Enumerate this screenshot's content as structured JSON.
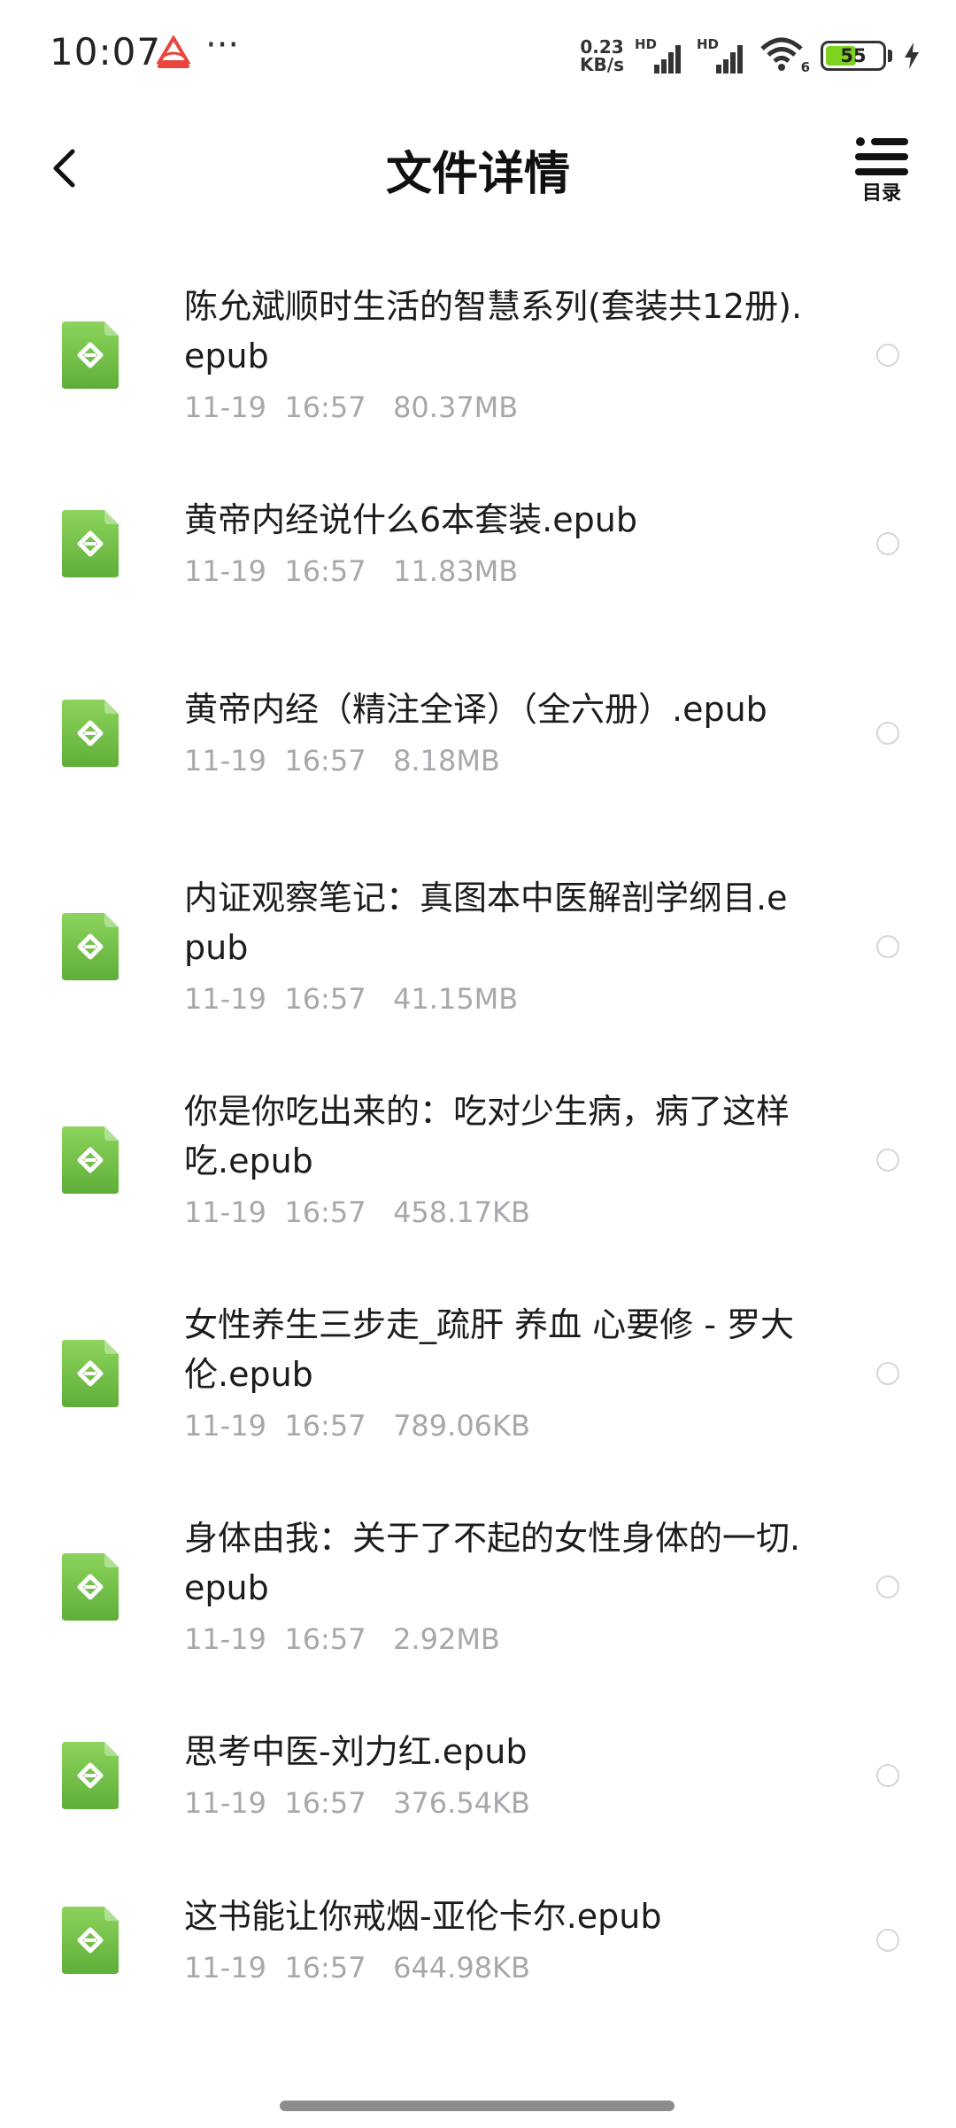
{
  "status_bar": {
    "time": "10:07",
    "dots": "···",
    "net_speed_value": "0.23",
    "net_speed_unit": "KB/s",
    "hd1": "HD",
    "hd2": "HD",
    "wifi_label": "6",
    "battery_percent": "55",
    "battery_level": 0.55,
    "battery_color": "#7ed321",
    "icons": [
      "app-notification-icon",
      "signal-icon",
      "wifi-icon",
      "battery-icon",
      "charging-icon"
    ]
  },
  "header": {
    "title": "文件详情",
    "toc_label": "目录",
    "back_icon": "chevron-left-icon",
    "toc_icon": "list-icon"
  },
  "files": [
    {
      "name": "陈允斌顺时生活的智慧系列(套装共12册).epub",
      "date": "11-19",
      "time": "16:57",
      "size": "80.37MB"
    },
    {
      "name": "黄帝内经说什么6本套装.epub",
      "date": "11-19",
      "time": "16:57",
      "size": "11.83MB"
    },
    {
      "name": "黄帝内经（精注全译）（全六册）.epub",
      "date": "11-19",
      "time": "16:57",
      "size": "8.18MB"
    },
    {
      "name": "内证观察笔记：真图本中医解剖学纲目.epub",
      "date": "11-19",
      "time": "16:57",
      "size": "41.15MB"
    },
    {
      "name": "你是你吃出来的：吃对少生病，病了这样吃.epub",
      "date": "11-19",
      "time": "16:57",
      "size": "458.17KB"
    },
    {
      "name": "女性养生三步走_疏肝 养血 心要修 - 罗大伦.epub",
      "date": "11-19",
      "time": "16:57",
      "size": "789.06KB"
    },
    {
      "name": "身体由我：关于了不起的女性身体的一切.epub",
      "date": "11-19",
      "time": "16:57",
      "size": "2.92MB"
    },
    {
      "name": "思考中医-刘力红.epub",
      "date": "11-19",
      "time": "16:57",
      "size": "376.54KB"
    },
    {
      "name": "这书能让你戒烟-亚伦卡尔.epub",
      "date": "11-19",
      "time": "16:57",
      "size": "644.98KB"
    }
  ],
  "colors": {
    "epub_icon_top": "#8cd45c",
    "epub_icon_bottom": "#5fae3a",
    "meta_text": "#a6a8ad"
  }
}
